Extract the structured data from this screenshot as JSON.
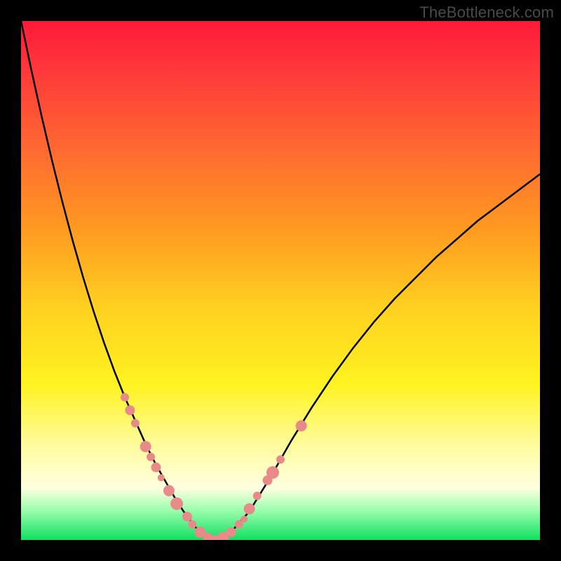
{
  "watermark": "TheBottleneck.com",
  "colors": {
    "frame_bg": "#000000",
    "curve": "#000000",
    "marker_fill": "#e98a8a",
    "marker_stroke": "#d87070"
  },
  "chart_data": {
    "type": "line",
    "title": "",
    "xlabel": "",
    "ylabel": "",
    "xlim": [
      0,
      100
    ],
    "ylim": [
      0,
      100
    ],
    "grid": false,
    "series": [
      {
        "name": "bottleneck-curve",
        "x": [
          0,
          2,
          4,
          6,
          8,
          10,
          12,
          14,
          16,
          18,
          20,
          22,
          24,
          26,
          28,
          30,
          32,
          34,
          36,
          38,
          40,
          44,
          48,
          52,
          56,
          60,
          64,
          68,
          72,
          76,
          80,
          84,
          88,
          92,
          96,
          100
        ],
        "values": [
          100,
          90.5,
          81.5,
          73,
          65,
          57.5,
          50.5,
          44,
          38,
          32.5,
          27.5,
          23,
          18.5,
          14.5,
          11,
          7.5,
          4.5,
          2,
          0.5,
          0,
          1,
          5.5,
          12,
          19,
          25.5,
          31.5,
          37,
          42,
          46.5,
          50.5,
          54.5,
          58,
          61.5,
          64.5,
          67.5,
          70.5
        ]
      }
    ],
    "points": [
      {
        "x": 20,
        "y": 27.5,
        "r": 6
      },
      {
        "x": 21,
        "y": 25,
        "r": 7
      },
      {
        "x": 22,
        "y": 22.5,
        "r": 6
      },
      {
        "x": 24,
        "y": 18,
        "r": 8
      },
      {
        "x": 25,
        "y": 16,
        "r": 6
      },
      {
        "x": 26,
        "y": 14,
        "r": 7
      },
      {
        "x": 27,
        "y": 12,
        "r": 5
      },
      {
        "x": 28.5,
        "y": 9.5,
        "r": 8
      },
      {
        "x": 30,
        "y": 7,
        "r": 9
      },
      {
        "x": 32,
        "y": 4.5,
        "r": 7
      },
      {
        "x": 33,
        "y": 3,
        "r": 6
      },
      {
        "x": 34.5,
        "y": 1.5,
        "r": 8
      },
      {
        "x": 36,
        "y": 0.5,
        "r": 7
      },
      {
        "x": 37.5,
        "y": 0,
        "r": 7
      },
      {
        "x": 39,
        "y": 0.5,
        "r": 8
      },
      {
        "x": 40.5,
        "y": 1.5,
        "r": 7
      },
      {
        "x": 42,
        "y": 3,
        "r": 6
      },
      {
        "x": 43,
        "y": 4,
        "r": 5
      },
      {
        "x": 44,
        "y": 6,
        "r": 8
      },
      {
        "x": 45.5,
        "y": 8.5,
        "r": 6
      },
      {
        "x": 47.5,
        "y": 11.5,
        "r": 7
      },
      {
        "x": 48.5,
        "y": 13,
        "r": 9
      },
      {
        "x": 50,
        "y": 15.5,
        "r": 6
      },
      {
        "x": 54,
        "y": 22,
        "r": 8
      }
    ]
  }
}
